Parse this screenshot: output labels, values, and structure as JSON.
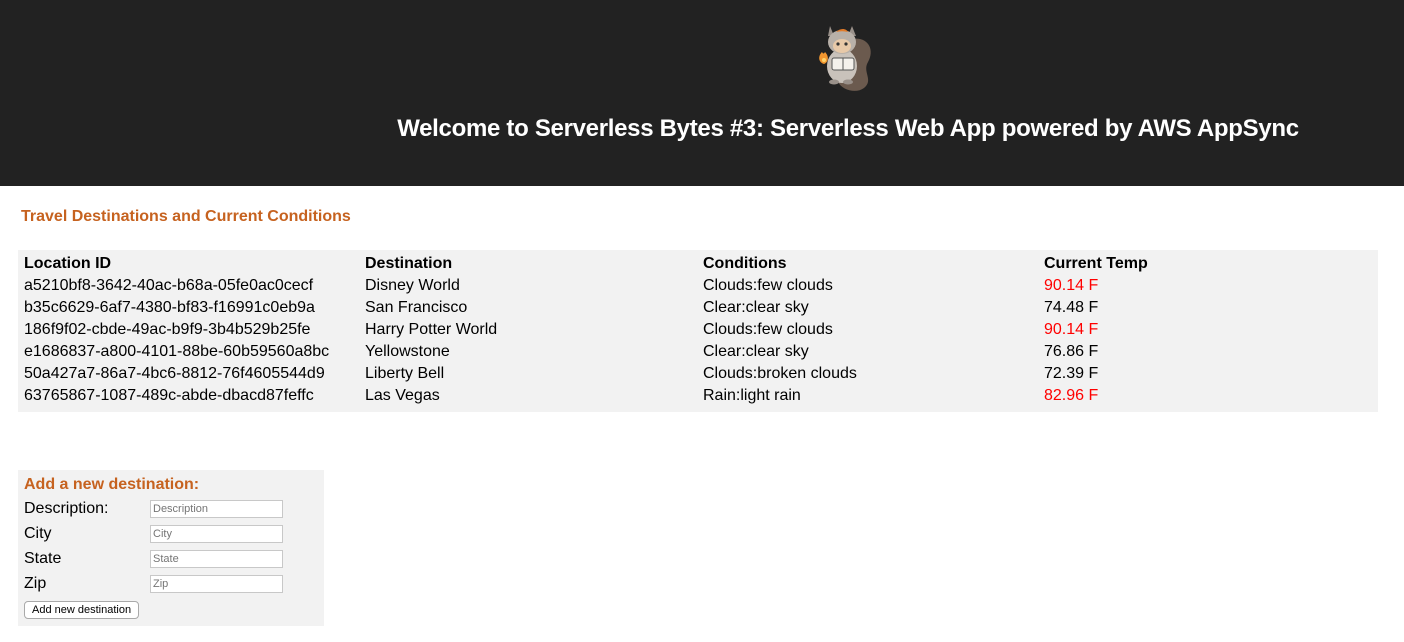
{
  "header": {
    "title": "Welcome to Serverless Bytes #3: Serverless Web App powered by AWS AppSync",
    "logo_icon": "squirrel-mascot-icon"
  },
  "destinations": {
    "title": "Travel Destinations and Current Conditions",
    "columns": [
      "Location ID",
      "Destination",
      "Conditions",
      "Current Temp"
    ],
    "rows": [
      {
        "id": "a5210bf8-3642-40ac-b68a-05fe0ac0cecf",
        "destination": "Disney World",
        "conditions": "Clouds:few clouds",
        "temp": "90.14 F",
        "hot": true
      },
      {
        "id": "b35c6629-6af7-4380-bf83-f16991c0eb9a",
        "destination": "San Francisco",
        "conditions": "Clear:clear sky",
        "temp": "74.48 F",
        "hot": false
      },
      {
        "id": "186f9f02-cbde-49ac-b9f9-3b4b529b25fe",
        "destination": "Harry Potter World",
        "conditions": "Clouds:few clouds",
        "temp": "90.14 F",
        "hot": true
      },
      {
        "id": "e1686837-a800-4101-88be-60b59560a8bc",
        "destination": "Yellowstone",
        "conditions": "Clear:clear sky",
        "temp": "76.86 F",
        "hot": false
      },
      {
        "id": "50a427a7-86a7-4bc6-8812-76f4605544d9",
        "destination": "Liberty Bell",
        "conditions": "Clouds:broken clouds",
        "temp": "72.39 F",
        "hot": false
      },
      {
        "id": "63765867-1087-489c-abde-dbacd87feffc",
        "destination": "Las Vegas",
        "conditions": "Rain:light rain",
        "temp": "82.96 F",
        "hot": true
      }
    ]
  },
  "form": {
    "title": "Add a new destination:",
    "fields": [
      {
        "label": "Description:",
        "placeholder": "Description",
        "value": ""
      },
      {
        "label": "City",
        "placeholder": "City",
        "value": ""
      },
      {
        "label": "State",
        "placeholder": "State",
        "value": ""
      },
      {
        "label": "Zip",
        "placeholder": "Zip",
        "value": ""
      }
    ],
    "submit_label": "Add new destination"
  },
  "colors": {
    "header_bg": "#222222",
    "accent": "#c6621f",
    "hot_temp": "#ff0000",
    "panel_bg": "#f2f2f2"
  }
}
